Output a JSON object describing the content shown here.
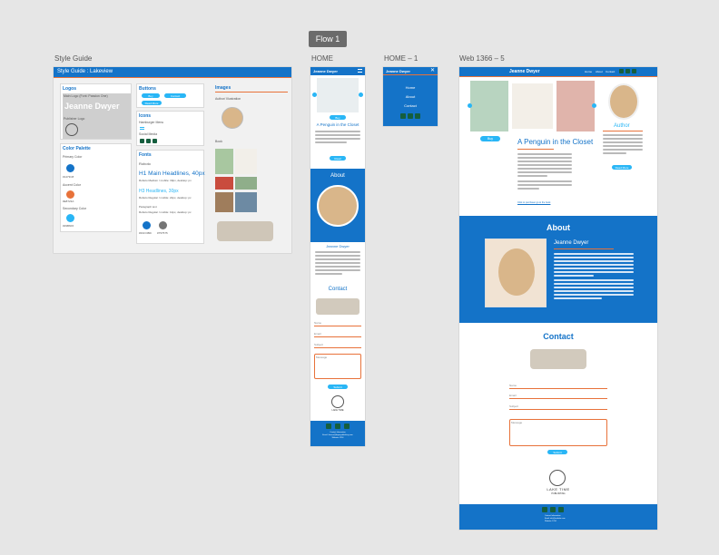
{
  "canvas": {
    "flow_badge": "Flow 1",
    "labels": {
      "style_guide": "Style Guide",
      "home": "HOME",
      "home_1": "HOME – 1",
      "web": "Web 1366 – 5"
    }
  },
  "style_guide": {
    "header": "Style Guide : Lakeview",
    "logos_title": "Logos",
    "main_logo_label": "Main Logo (Font: Passion One)",
    "main_logo_text": "Jeanne Dwyer",
    "publisher_logo_label": "Publisher Logo",
    "buttons_title": "Buttons",
    "button_labels": [
      "Buy",
      "Contact",
      "Read More"
    ],
    "icons_title": "Icons",
    "hamburger_label": "Hamburger Menu",
    "social_label": "Social Media",
    "fonts_title": "Fonts",
    "font_name": "Roboto",
    "h1_sample": "H1 Main Headlines, 40px",
    "h1_caption": "Roboto Medium / mobile: 30px, desktop: px",
    "h3_sample": "H3 Headlines, 30px",
    "h3_caption": "Roboto Regular / mobile: 22px, desktop: px",
    "para_label": "Paragraph text",
    "para_caption": "Roboto Regular / mobile: 12px, desktop: px",
    "swatch_labels_bottom": [
      "#333 DBD",
      "#757575"
    ],
    "color_palette_title": "Color Palette",
    "primary_label": "Primary Color",
    "primary_hex": "#1473C8",
    "accent_label": "Accent Color",
    "accent_hex": "#E8723A",
    "secondary_label": "Secondary Color",
    "secondary_hex": "#29B6F6",
    "images_title": "Images",
    "author_illustration_label": "Author/ Illustration",
    "book_label": "Book",
    "colors": {
      "primary": "#1473c8",
      "accent": "#e8723a",
      "secondary": "#29b6f6",
      "dark": "#333333",
      "grey": "#757575"
    }
  },
  "mobile_home": {
    "brand": "Jeanne Dwyer",
    "buy": "Buy",
    "book_title": "A Penguin in the Closet",
    "read_more": "Read",
    "about_title": "About",
    "author_name": "Jeanne Dwyer",
    "contact_title": "Contact",
    "fields": [
      "Name",
      "Email",
      "Subject",
      "Message"
    ],
    "submit": "Submit",
    "publisher_logo": "LAKE TIME",
    "footer_lines": [
      "Contact Information",
      "Email: Jeanne@dwyerpublishing.com",
      "Website: 1234"
    ]
  },
  "mobile_menu": {
    "brand": "Jeanne Dwyer",
    "items": [
      "Home",
      "About",
      "Contact"
    ]
  },
  "web": {
    "brand": "Jeanne Dwyer",
    "nav": [
      "Home",
      "About",
      "Contact"
    ],
    "buy": "Buy",
    "book_title": "A Penguin in the Closet",
    "purchase_link": "Click to purchase/ go to the book",
    "author_title": "Author",
    "read_more": "Read More",
    "about_title": "About",
    "author_name": "Jeanne Dwyer",
    "contact_title": "Contact",
    "fields": [
      "Name",
      "Email",
      "Subject",
      "Message"
    ],
    "submit": "Submit",
    "publisher_logo": "LAKE TIME",
    "publisher_sub": "PUBLISHING",
    "footer_lines": [
      "Contact Information",
      "Email: info@website.com",
      "Website: 1234"
    ]
  }
}
